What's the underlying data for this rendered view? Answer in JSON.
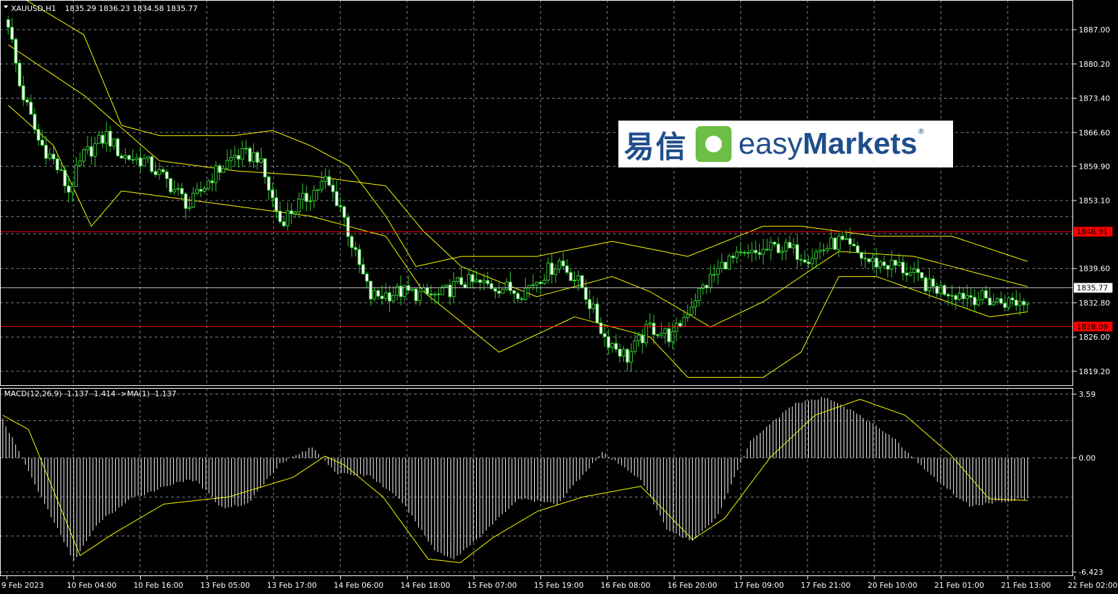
{
  "header": {
    "symbol": "XAUUSD,H1",
    "ohlc": "1835.29 1836.23 1834.58 1835.77"
  },
  "macd_header": "MACD(12,26,9) -1.137 -1.414  ->MA(1) -1.137",
  "logo": {
    "cn": "易信",
    "en_light": "easy",
    "en_bold": "Markets",
    "reg": "®"
  },
  "colors": {
    "bg": "#000000",
    "grid": "#7f8791",
    "candle": "#32cd32",
    "bull_body": "#000000",
    "bands": "#ffff00",
    "level": "#ff0000",
    "macd_hist": "#ffffff",
    "signal": "#ffff00"
  },
  "chart_data": [
    {
      "type": "candlestick",
      "title": "XAUUSD,H1",
      "indicator": "Bollinger Bands",
      "ylim": [
        1816.3,
        1892.9
      ],
      "y_ticks": [
        "1887.00",
        "1880.20",
        "1873.40",
        "1866.60",
        "1859.90",
        "1853.10",
        "1839.60",
        "1832.80",
        "1826.00",
        "1819.20"
      ],
      "price_labels": {
        "upper_level": "1846.91",
        "lower_level": "1828.09",
        "current": "1835.77"
      },
      "x_ticks": [
        "9 Feb 2023",
        "10 Feb 04:00",
        "10 Feb 16:00",
        "13 Feb 05:00",
        "13 Feb 17:00",
        "14 Feb 06:00",
        "14 Feb 18:00",
        "15 Feb 07:00",
        "15 Feb 19:00",
        "16 Feb 08:00",
        "16 Feb 20:00",
        "17 Feb 09:00",
        "17 Feb 21:00",
        "20 Feb 10:00",
        "21 Feb 01:00",
        "21 Feb 13:00",
        "22 Feb 02:00"
      ],
      "close_anchors": [
        [
          0,
          1888.5
        ],
        [
          3,
          1876
        ],
        [
          8,
          1865
        ],
        [
          12,
          1861
        ],
        [
          16,
          1855
        ],
        [
          20,
          1862
        ],
        [
          26,
          1866
        ],
        [
          30,
          1862
        ],
        [
          36,
          1861
        ],
        [
          42,
          1857
        ],
        [
          48,
          1852
        ],
        [
          54,
          1858
        ],
        [
          60,
          1862
        ],
        [
          66,
          1862
        ],
        [
          72,
          1849
        ],
        [
          78,
          1853
        ],
        [
          84,
          1857
        ],
        [
          88,
          1852
        ],
        [
          92,
          1842
        ],
        [
          96,
          1834
        ],
        [
          104,
          1835
        ],
        [
          114,
          1834
        ],
        [
          120,
          1837
        ],
        [
          130,
          1836
        ],
        [
          136,
          1835
        ],
        [
          146,
          1841
        ],
        [
          152,
          1836
        ],
        [
          158,
          1826
        ],
        [
          164,
          1822
        ],
        [
          170,
          1828
        ],
        [
          176,
          1826
        ],
        [
          182,
          1834
        ],
        [
          190,
          1841
        ],
        [
          196,
          1842
        ],
        [
          204,
          1844
        ],
        [
          212,
          1842
        ],
        [
          220,
          1845
        ],
        [
          228,
          1841
        ],
        [
          236,
          1840
        ],
        [
          244,
          1836
        ],
        [
          250,
          1835
        ],
        [
          262,
          1833
        ],
        [
          270,
          1833
        ]
      ],
      "upper_band_anchors": [
        [
          0,
          1895
        ],
        [
          20,
          1886
        ],
        [
          30,
          1868
        ],
        [
          40,
          1866
        ],
        [
          60,
          1866
        ],
        [
          70,
          1867
        ],
        [
          80,
          1864
        ],
        [
          90,
          1860
        ],
        [
          100,
          1850
        ],
        [
          108,
          1840
        ],
        [
          120,
          1842
        ],
        [
          140,
          1842
        ],
        [
          160,
          1845
        ],
        [
          180,
          1842
        ],
        [
          200,
          1848
        ],
        [
          210,
          1848
        ],
        [
          230,
          1846
        ],
        [
          250,
          1846
        ],
        [
          270,
          1841
        ]
      ],
      "lower_band_anchors": [
        [
          0,
          1872
        ],
        [
          12,
          1864
        ],
        [
          22,
          1848
        ],
        [
          30,
          1855
        ],
        [
          60,
          1852
        ],
        [
          80,
          1850
        ],
        [
          100,
          1846
        ],
        [
          110,
          1835
        ],
        [
          130,
          1823
        ],
        [
          150,
          1830
        ],
        [
          170,
          1826
        ],
        [
          180,
          1818
        ],
        [
          200,
          1818
        ],
        [
          210,
          1823
        ],
        [
          220,
          1838
        ],
        [
          230,
          1838
        ],
        [
          260,
          1830
        ],
        [
          270,
          1831
        ]
      ],
      "middle_band_anchors": [
        [
          0,
          1884
        ],
        [
          20,
          1874
        ],
        [
          40,
          1861
        ],
        [
          60,
          1859
        ],
        [
          80,
          1858
        ],
        [
          100,
          1856
        ],
        [
          110,
          1847
        ],
        [
          120,
          1840
        ],
        [
          140,
          1834
        ],
        [
          160,
          1838
        ],
        [
          170,
          1835
        ],
        [
          186,
          1828
        ],
        [
          200,
          1833
        ],
        [
          220,
          1843
        ],
        [
          240,
          1842
        ],
        [
          270,
          1836
        ]
      ]
    },
    {
      "type": "bar",
      "title": "MACD(12,26,9)",
      "ylim": [
        -6.423,
        3.59
      ],
      "y_ticks": [
        "3.59",
        "0.00",
        "-6.423"
      ],
      "macd_anchors": [
        [
          0,
          2.2
        ],
        [
          10,
          -1.5
        ],
        [
          22,
          -5.8
        ],
        [
          30,
          -3.6
        ],
        [
          40,
          -2.3
        ],
        [
          55,
          -1.3
        ],
        [
          60,
          -1.3
        ],
        [
          68,
          -2.8
        ],
        [
          76,
          -2.6
        ],
        [
          86,
          -0.3
        ],
        [
          96,
          0.6
        ],
        [
          104,
          -0.9
        ],
        [
          114,
          -1.0
        ],
        [
          124,
          -2.5
        ],
        [
          134,
          -5.2
        ],
        [
          140,
          -5.7
        ],
        [
          150,
          -4.1
        ],
        [
          160,
          -2.3
        ],
        [
          172,
          -2.6
        ],
        [
          186,
          0.3
        ],
        [
          198,
          -1.2
        ],
        [
          206,
          -4.0
        ],
        [
          214,
          -4.7
        ],
        [
          222,
          -3.2
        ],
        [
          232,
          1.0
        ],
        [
          246,
          3.1
        ],
        [
          256,
          3.4
        ],
        [
          264,
          2.6
        ],
        [
          276,
          1.2
        ],
        [
          288,
          -1.0
        ],
        [
          300,
          -2.7
        ],
        [
          312,
          -2.4
        ],
        [
          318,
          -2.3
        ]
      ],
      "signal_anchors": [
        [
          0,
          2.4
        ],
        [
          8,
          1.6
        ],
        [
          24,
          -5.5
        ],
        [
          34,
          -4.3
        ],
        [
          50,
          -2.6
        ],
        [
          70,
          -2.2
        ],
        [
          90,
          -1.1
        ],
        [
          100,
          0.1
        ],
        [
          106,
          -0.4
        ],
        [
          118,
          -2.2
        ],
        [
          132,
          -5.7
        ],
        [
          142,
          -5.9
        ],
        [
          152,
          -4.5
        ],
        [
          166,
          -3.0
        ],
        [
          180,
          -2.2
        ],
        [
          198,
          -1.6
        ],
        [
          214,
          -4.6
        ],
        [
          224,
          -3.4
        ],
        [
          238,
          0.0
        ],
        [
          252,
          2.4
        ],
        [
          266,
          3.3
        ],
        [
          280,
          2.4
        ],
        [
          294,
          0.2
        ],
        [
          306,
          -2.3
        ],
        [
          318,
          -2.4
        ]
      ]
    }
  ]
}
